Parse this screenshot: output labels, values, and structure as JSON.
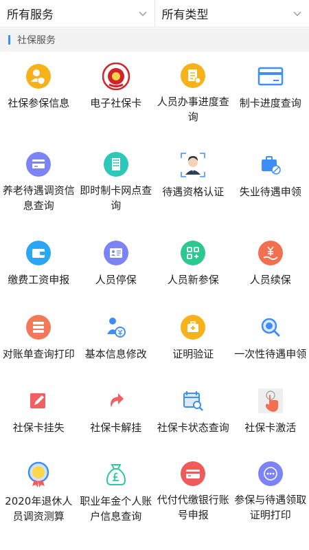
{
  "filters": [
    {
      "label": "所有服务",
      "icon": "chevron-down-icon"
    },
    {
      "label": "所有类型",
      "icon": "chevron-down-icon"
    }
  ],
  "section": {
    "title": "社保服务",
    "accent_color": "#3d8ef7"
  },
  "items": [
    {
      "label": "社保参保信息",
      "icon": "user-shield-icon",
      "color": "#f7b21b"
    },
    {
      "label": "电子社保卡",
      "icon": "social-security-emblem-icon",
      "color": "#d0242a"
    },
    {
      "label": "人员办事进度查询",
      "icon": "document-progress-icon",
      "color": "#f7b21b"
    },
    {
      "label": "制卡进度查询",
      "icon": "card-icon",
      "color": "#3d8ef7"
    },
    {
      "label": "养老待遇调资信息查询",
      "icon": "card-adjust-icon",
      "color": "#7b83f5"
    },
    {
      "label": "即时制卡网点查询",
      "icon": "building-icon",
      "color": "#2cc8b8"
    },
    {
      "label": "待遇资格认证",
      "icon": "face-auth-icon",
      "color": "#3d8ef7"
    },
    {
      "label": "失业待遇申领",
      "icon": "briefcase-icon",
      "color": "#3d8ef7"
    },
    {
      "label": "缴费工资申报",
      "icon": "wallet-icon",
      "color": "#2aa7f0"
    },
    {
      "label": "人员停保",
      "icon": "id-card-icon",
      "color": "#7b83f5"
    },
    {
      "label": "人员新参保",
      "icon": "grid-add-icon",
      "color": "#2cc890"
    },
    {
      "label": "人员续保",
      "icon": "yen-hand-icon",
      "color": "#f07050"
    },
    {
      "label": "对账单查询打印",
      "icon": "statement-list-icon",
      "color": "#f07a5a"
    },
    {
      "label": "基本信息修改",
      "icon": "person-yen-icon",
      "color": "#3d8ef7"
    },
    {
      "label": "证明验证",
      "icon": "medical-kit-icon",
      "color": "#f7b21b"
    },
    {
      "label": "一次性待遇申领",
      "icon": "search-stamp-icon",
      "color": "#3d8ef7"
    },
    {
      "label": "社保卡挂失",
      "icon": "edit-card-icon",
      "color": "#f06060"
    },
    {
      "label": "社保卡解挂",
      "icon": "undo-arrow-icon",
      "color": "#f06060"
    },
    {
      "label": "社保卡状态查询",
      "icon": "calendar-search-icon",
      "color": "#3d8ef7"
    },
    {
      "label": "社保卡激活",
      "icon": "hand-touch-icon",
      "color": "#f07050"
    },
    {
      "label": "2020年退休人员调资测算",
      "icon": "certificate-icon",
      "color": "#3d8ef7"
    },
    {
      "label": "职业年金个人账户信息查询",
      "icon": "money-bag-icon",
      "color": "#2cc8a0"
    },
    {
      "label": "代付代缴银行账号申报",
      "icon": "bank-card-icon",
      "color": "#f05a5a"
    },
    {
      "label": "参保与待遇领取证明打印",
      "icon": "more-icon",
      "color": "#7b83f5"
    }
  ]
}
